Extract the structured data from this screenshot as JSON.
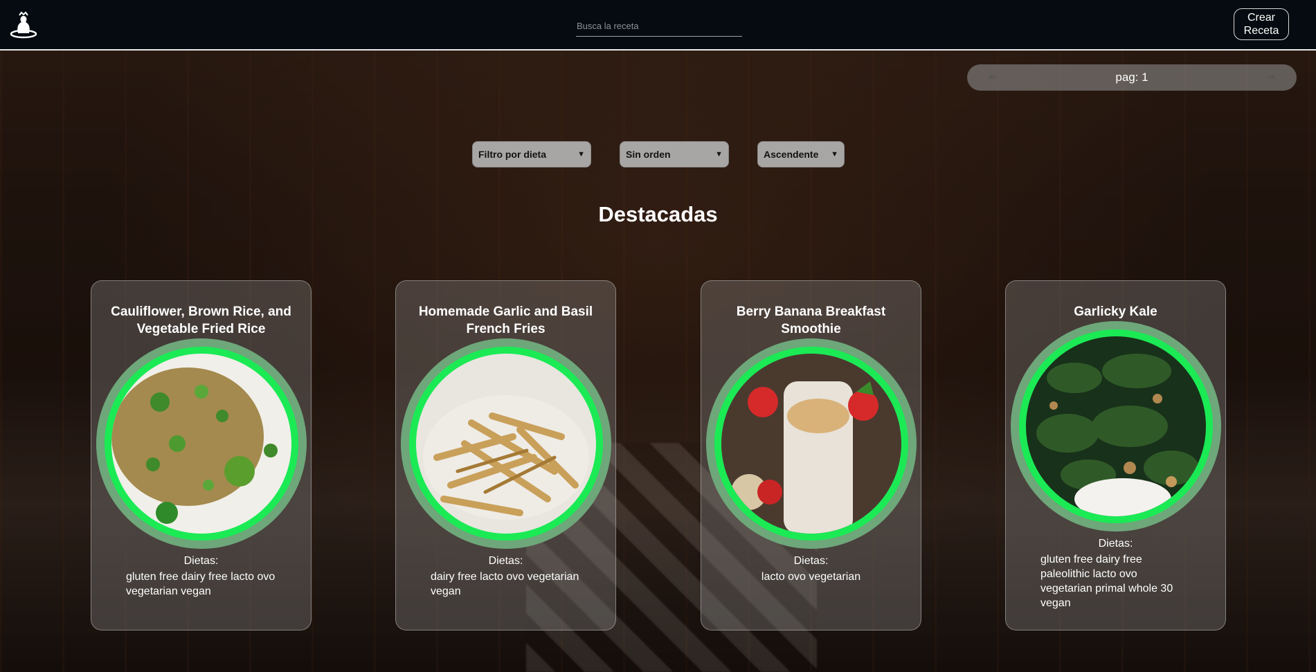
{
  "header": {
    "search_placeholder": "Busca la receta",
    "create_button": "Crear\nReceta"
  },
  "pager": {
    "prev_icon": "arrow-left-to-line-icon",
    "label": "pag: 1",
    "next_icon": "arrow-right-to-line-icon"
  },
  "filters": {
    "diet": "Filtro por dieta",
    "order": "Sin orden",
    "direction": "Ascendente"
  },
  "section_title": "Destacadas",
  "colors": {
    "header_bg": "#050b10",
    "ring_outer": "#6ea77a",
    "ring_inner": "#1bea55"
  },
  "cards": [
    {
      "title": "Cauliflower, Brown Rice, and Vegetable Fried Rice",
      "dietas_label": "Dietas:",
      "dietas": "gluten free dairy free lacto ovo vegetarian vegan"
    },
    {
      "title": "Homemade Garlic and Basil French Fries",
      "dietas_label": "Dietas:",
      "dietas": "dairy free lacto ovo vegetarian vegan"
    },
    {
      "title": "Berry Banana Breakfast Smoothie",
      "dietas_label": "Dietas:",
      "dietas": "lacto ovo vegetarian"
    },
    {
      "title": "Garlicky Kale",
      "dietas_label": "Dietas:",
      "dietas": "gluten free dairy free paleolithic lacto ovo vegetarian primal whole 30 vegan"
    }
  ]
}
